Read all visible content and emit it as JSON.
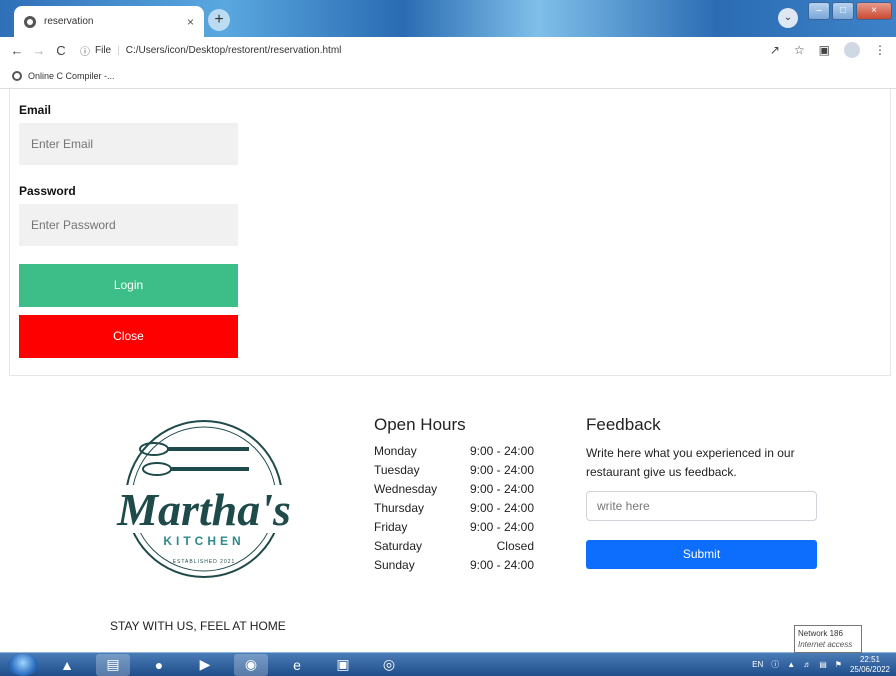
{
  "browser": {
    "tab_title": "reservation",
    "tab_close": "×",
    "new_tab": "+",
    "url_scheme": "File",
    "url_path": "C:/Users/icon/Desktop/restorent/reservation.html",
    "bookmark_label": "Online C Compiler -..."
  },
  "form": {
    "email_label": "Email",
    "email_placeholder": "Enter Email",
    "password_label": "Password",
    "password_placeholder": "Enter Password",
    "login_label": "Login",
    "close_label": "Close"
  },
  "footer": {
    "logo_title": "Martha's",
    "logo_subtitle": "KITCHEN",
    "logo_established": "ESTABLISHED 2021",
    "tagline": "STAY WITH US, FEEL AT HOME",
    "hours_title": "Open Hours",
    "hours": [
      {
        "day": "Monday",
        "time": "9:00 - 24:00"
      },
      {
        "day": "Tuesday",
        "time": "9:00 - 24:00"
      },
      {
        "day": "Wednesday",
        "time": "9:00 - 24:00"
      },
      {
        "day": "Thursday",
        "time": "9:00 - 24:00"
      },
      {
        "day": "Friday",
        "time": "9:00 - 24:00"
      },
      {
        "day": "Saturday",
        "time": "Closed"
      },
      {
        "day": "Sunday",
        "time": "9:00 - 24:00"
      }
    ],
    "feedback_title": "Feedback",
    "feedback_text": "Write here what you experienced in our restaurant give us feedback.",
    "feedback_placeholder": "write here",
    "submit_label": "Submit"
  },
  "tooltip": {
    "line1": "Network 186",
    "line2": "Internet access"
  },
  "taskbar": {
    "lang": "EN",
    "time": "22:51",
    "date": "25/06/2022"
  },
  "colors": {
    "login": "#3dbd87",
    "close": "#ff0000",
    "submit": "#0d6efd",
    "logo": "#1f4a4a"
  }
}
